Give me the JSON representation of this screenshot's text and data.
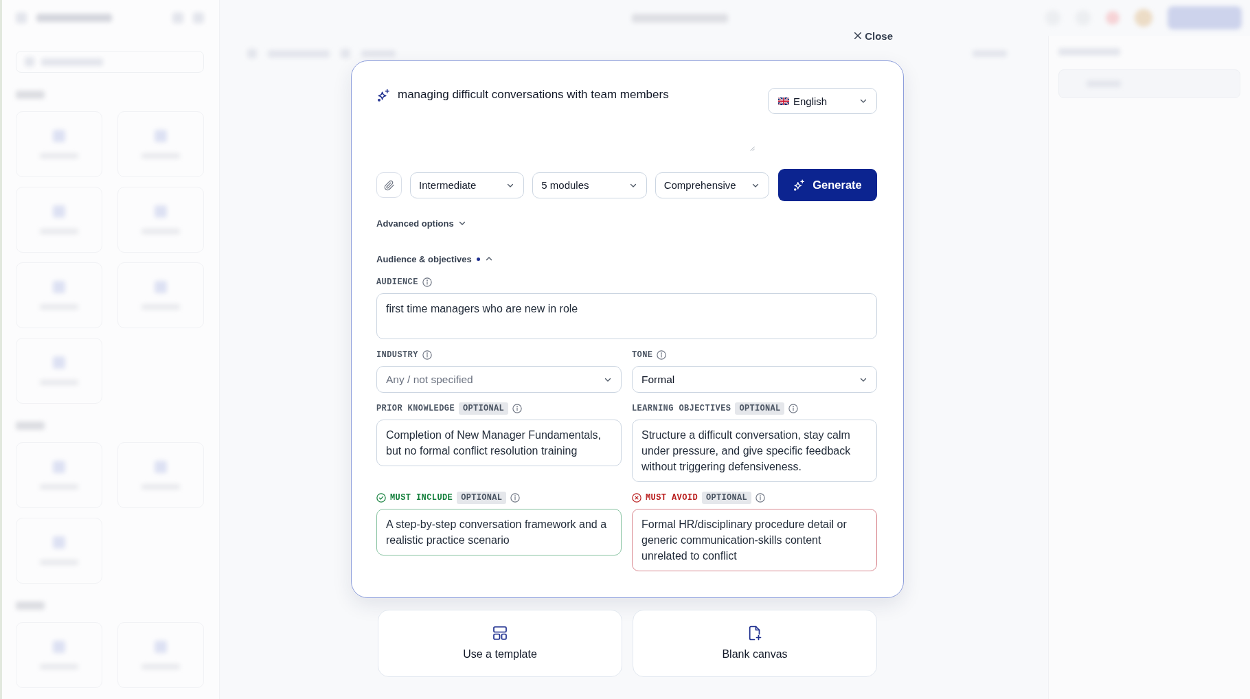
{
  "close_button": {
    "label": "Close"
  },
  "prompt": {
    "value": "managing difficult conversations with team members"
  },
  "language_select": {
    "value": "English"
  },
  "option_selects": [
    {
      "value": "Intermediate"
    },
    {
      "value": "5 modules"
    },
    {
      "value": "Comprehensive"
    }
  ],
  "generate_button": {
    "label": "Generate"
  },
  "advanced_options": {
    "label": "Advanced options",
    "expanded": false
  },
  "audience_section": {
    "label": "Audience & objectives",
    "expanded": true,
    "edited": true,
    "field_rows": [
      {
        "fields": [
          {
            "kind": "text",
            "label": "AUDIENCE",
            "value": "first time managers who are new in role"
          }
        ]
      },
      {
        "fields": [
          {
            "kind": "select",
            "label": "INDUSTRY",
            "placeholder": "Any / not specified"
          },
          {
            "kind": "select",
            "label": "TONE",
            "value": "Formal"
          }
        ]
      },
      {
        "fields": [
          {
            "kind": "text",
            "label": "PRIOR KNOWLEDGE",
            "badge": "OPTIONAL",
            "value": "Completion of New Manager Fundamentals, but no formal conflict resolution training"
          },
          {
            "kind": "text",
            "label": "LEARNING OBJECTIVES",
            "badge": "OPTIONAL",
            "value": "Structure a difficult conversation, stay calm under pressure, and give specific feedback without triggering defensiveness."
          }
        ]
      },
      {
        "fields": [
          {
            "kind": "include",
            "label": "MUST INCLUDE",
            "badge": "OPTIONAL",
            "value": "A step-by-step conversation framework and a realistic practice scenario"
          },
          {
            "kind": "avoid",
            "label": "MUST AVOID",
            "badge": "OPTIONAL",
            "value": "Formal HR/disciplinary procedure detail or generic communication-skills content unrelated to conflict"
          }
        ]
      }
    ]
  },
  "start_options": [
    {
      "kind": "template",
      "label": "Use a template"
    },
    {
      "kind": "blank",
      "label": "Blank canvas"
    }
  ]
}
